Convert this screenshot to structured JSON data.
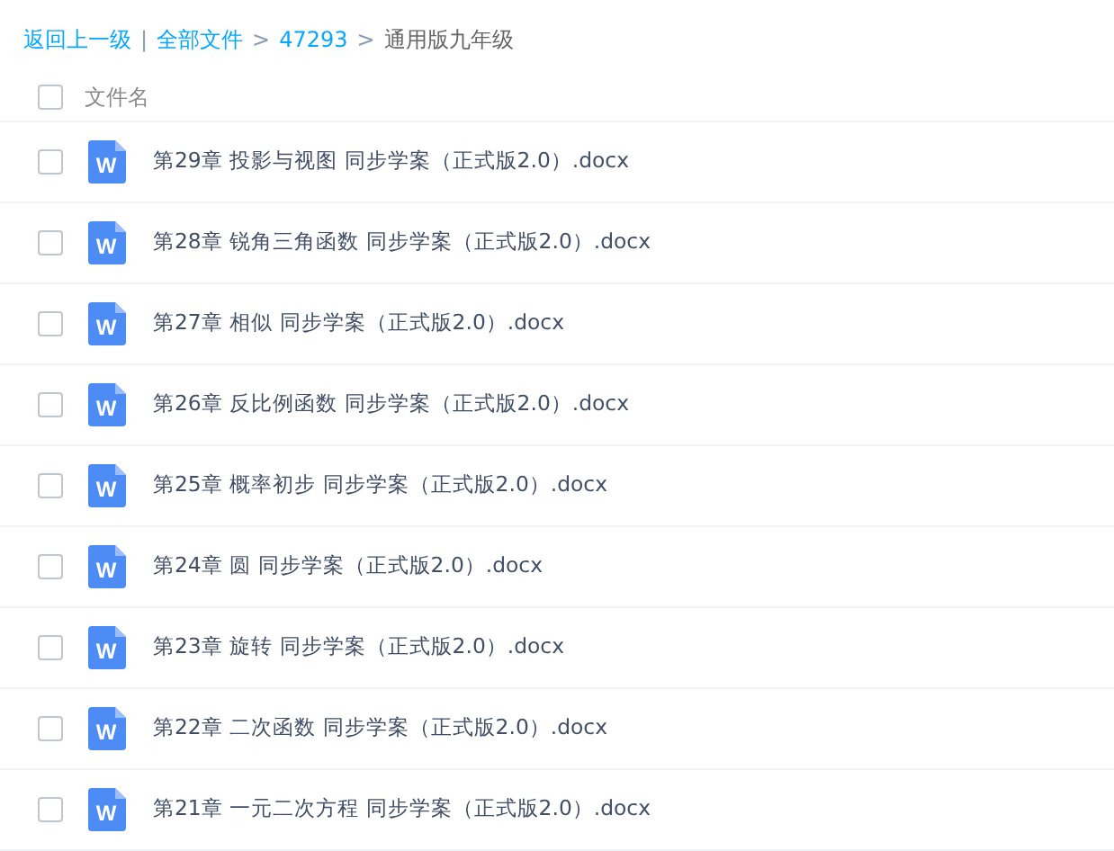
{
  "breadcrumb": [
    {
      "kind": "link",
      "text": "返回上一级"
    },
    {
      "kind": "sep",
      "text": "|"
    },
    {
      "kind": "link",
      "text": "全部文件"
    },
    {
      "kind": "sep",
      "text": ">"
    },
    {
      "kind": "link",
      "text": "47293"
    },
    {
      "kind": "sep",
      "text": ">"
    },
    {
      "kind": "current",
      "text": "通用版九年级"
    }
  ],
  "header": {
    "checked": false,
    "label": "文件名"
  },
  "files": [
    {
      "checked": false,
      "icon_letter": "W",
      "name": "第29章 投影与视图 同步学案（正式版2.0）.docx"
    },
    {
      "checked": false,
      "icon_letter": "W",
      "name": "第28章 锐角三角函数 同步学案（正式版2.0）.docx"
    },
    {
      "checked": false,
      "icon_letter": "W",
      "name": "第27章 相似 同步学案（正式版2.0）.docx"
    },
    {
      "checked": false,
      "icon_letter": "W",
      "name": "第26章 反比例函数 同步学案（正式版2.0）.docx"
    },
    {
      "checked": false,
      "icon_letter": "W",
      "name": "第25章 概率初步 同步学案（正式版2.0）.docx"
    },
    {
      "checked": false,
      "icon_letter": "W",
      "name": "第24章 圆 同步学案（正式版2.0）.docx"
    },
    {
      "checked": false,
      "icon_letter": "W",
      "name": "第23章 旋转 同步学案（正式版2.0）.docx"
    },
    {
      "checked": false,
      "icon_letter": "W",
      "name": "第22章 二次函数 同步学案（正式版2.0）.docx"
    },
    {
      "checked": false,
      "icon_letter": "W",
      "name": "第21章 一元二次方程 同步学案（正式版2.0）.docx"
    }
  ]
}
